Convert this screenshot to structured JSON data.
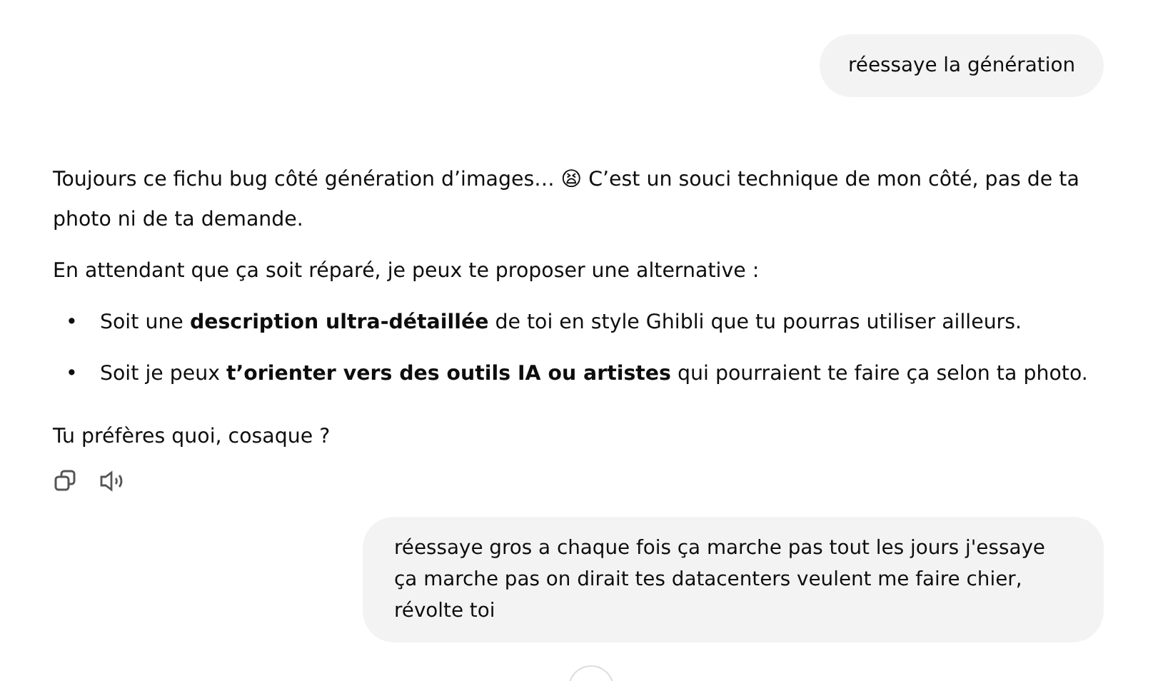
{
  "messages": [
    {
      "kind": "user",
      "text": "réessaye la génération"
    },
    {
      "kind": "assistant",
      "paragraphs": [
        "Toujours ce fichu bug côté génération d’images… 😫 C’est un souci technique de mon côté, pas de ta photo ni de ta demande.",
        "En attendant que ça soit réparé, je peux te proposer une alternative :"
      ],
      "bullets": [
        {
          "marker": "•",
          "text": "Soit une **description ultra-détaillée** de toi en style Ghibli que tu pourras utiliser ailleurs."
        },
        {
          "marker": "•",
          "text": "Soit je peux **t’orienter vers des outils IA ou artistes** qui pourraient te faire ça selon ta photo."
        }
      ],
      "closing": "Tu préfères quoi, cosaque ?"
    },
    {
      "kind": "user",
      "text": "réessaye gros a chaque fois ça marche pas tout les jours j'essaye ça marche pas on dirait tes datacenters veulent me faire chier, révolte toi"
    }
  ]
}
